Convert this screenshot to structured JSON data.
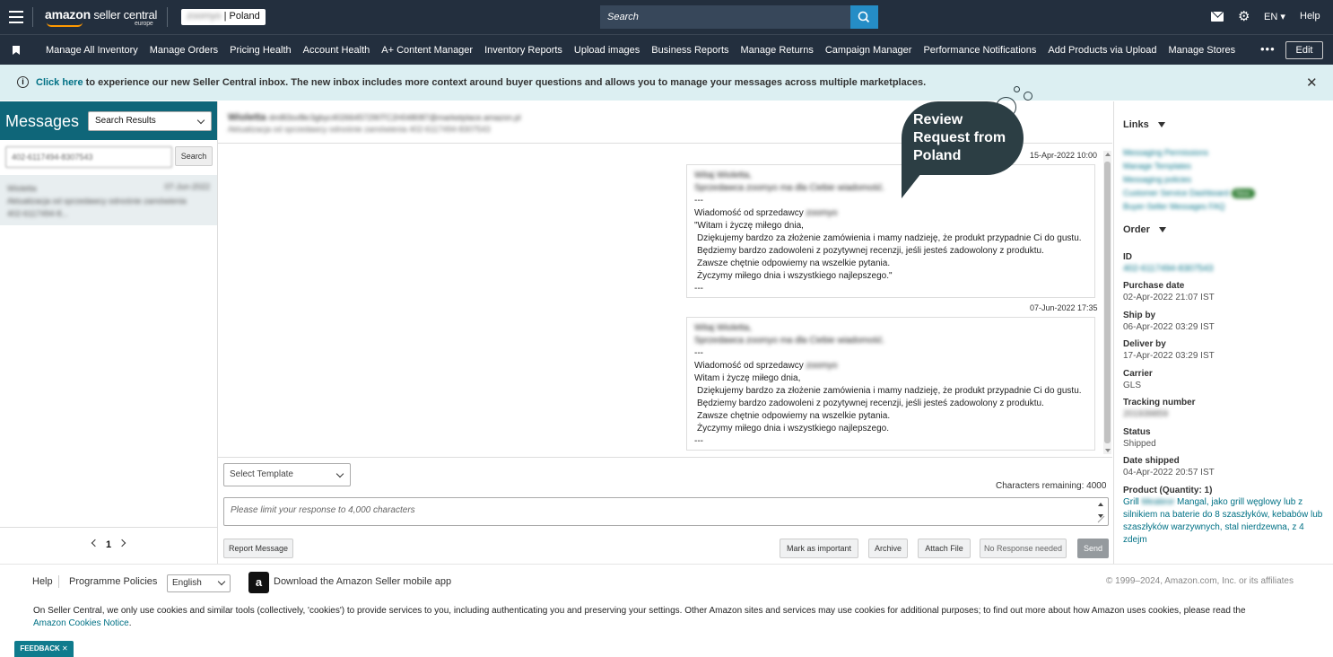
{
  "topbar": {
    "logo_main": "amazon",
    "logo_rest": " seller central",
    "logo_sub": "europe",
    "store_name": "zoomyo",
    "store_country": " | Poland",
    "search_placeholder": "Search",
    "lang": "EN ▾",
    "help": "Help"
  },
  "nav": {
    "items": [
      "Manage All Inventory",
      "Manage Orders",
      "Pricing Health",
      "Account Health",
      "A+ Content Manager",
      "Inventory Reports",
      "Upload images",
      "Business Reports",
      "Manage Returns",
      "Campaign Manager",
      "Performance Notifications",
      "Add Products via Upload",
      "Manage Stores"
    ],
    "more": "•••",
    "edit": "Edit"
  },
  "banner": {
    "link": "Click here",
    "text": " to experience our new Seller Central inbox. The new inbox includes more context around buyer questions and allows you to manage your messages across multiple marketplaces.",
    "close": "✕"
  },
  "left": {
    "title": "Messages",
    "filter": "Search Results",
    "search_value": "402-6117494-8307543",
    "search_btn": "Search",
    "conversation": {
      "name": "Wioletta",
      "date": "07-Jun-2022",
      "line1": "Aktualizacja od sprzedawcy odnośnie zamówienia",
      "line2": "402-6117494-8..."
    },
    "page": "1"
  },
  "center": {
    "buyer_name": "Wioletta",
    "buyer_email": "dm8l3sv8kr3gbyc40266457290TC2H048087@marketplace.amazon.pl",
    "subject": "Aktualizacja od sprzedawcy odnośnie zamówienia 402-6117494-8307543",
    "messages": [
      {
        "timestamp": "15-Apr-2022 10:00",
        "greeting": "Witaj Wioletta,",
        "intro": "Sprzedawca zoomyo ma dla Ciebie wiadomość.",
        "sep1": "---",
        "from_label": "Wiadomość od sprzedawcy ",
        "from_name": "zoomyo",
        "l1": "\"Witam i życzę miłego dnia,",
        "l2": "Dziękujemy bardzo za złożenie zamówienia i mamy nadzieję, że produkt przypadnie Ci do gustu.",
        "l3": "Będziemy bardzo zadowoleni z pozytywnej recenzji, jeśli jesteś zadowolony z produktu.",
        "l4": "Zawsze chętnie odpowiemy na wszelkie pytania.",
        "l5": "Życzymy miłego dnia i wszystkiego najlepszego.\"",
        "sep2": "---"
      },
      {
        "timestamp": "07-Jun-2022 17:35",
        "greeting": "Witaj Wioletta,",
        "intro": "Sprzedawca zoomyo ma dla Ciebie wiadomość.",
        "sep1": "---",
        "from_label": "Wiadomość od sprzedawcy ",
        "from_name": "zoomyo",
        "l1": "Witam i życzę miłego dnia,",
        "l2": "Dziękujemy bardzo za złożenie zamówienia i mamy nadzieję, że produkt przypadnie Ci do gustu.",
        "l3": "Będziemy bardzo zadowoleni z pozytywnej recenzji, jeśli jesteś zadowolony z produktu.",
        "l4": "Zawsze chętnie odpowiemy na wszelkie pytania.",
        "l5": "Życzymy miłego dnia i wszystkiego najlepszego.",
        "sep2": "---"
      }
    ],
    "template": "Select Template",
    "chars_remaining": "Characters remaining: 4000",
    "reply_placeholder": "Please limit your response to 4,000 characters",
    "buttons": {
      "report": "Report Message",
      "important": "Mark as important",
      "archive": "Archive",
      "attach": "Attach File",
      "noresp": "No Response needed",
      "send": "Send"
    }
  },
  "callout": {
    "text": "Review Request from Poland"
  },
  "right": {
    "links_title": "Links",
    "links": [
      "Messaging Permissions",
      "Manage Templates",
      "Messaging policies",
      "Customer Service Dashboard",
      "Buyer-Seller Messages FAQ"
    ],
    "links_pill": "New",
    "order_title": "Order",
    "fields": [
      {
        "label": "ID",
        "value": "402-6117494-8307543"
      },
      {
        "label": "Purchase date",
        "value": "02-Apr-2022 21:07 IST"
      },
      {
        "label": "Ship by",
        "value": "06-Apr-2022 03:29 IST"
      },
      {
        "label": "Deliver by",
        "value": "17-Apr-2022 03:29 IST"
      },
      {
        "label": "Carrier",
        "value": "GLS"
      },
      {
        "label": "Tracking number",
        "value": "201939859"
      },
      {
        "label": "Status",
        "value": "Shipped"
      },
      {
        "label": "Date shipped",
        "value": "04-Apr-2022 20:57 IST"
      }
    ],
    "product_label": "Product (Quantity: 1)",
    "product_pre": "Grill ",
    "product_brand": "Meateor",
    "product_rest": " Mangal, jako grill węglowy lub z silnikiem na baterie do 8 szaszłyków, kebabów lub szaszłyków warzywnych, stal nierdzewna, z 4 zdejm"
  },
  "footer": {
    "help": "Help",
    "policies": "Programme Policies",
    "language": "English",
    "app": "Download the Amazon Seller mobile app",
    "copyright": "© 1999–2024, Amazon.com, Inc. or its affiliates",
    "cookies": "On Seller Central, we only use cookies and similar tools (collectively, 'cookies') to provide services to you, including authenticating you and preserving your settings. Other Amazon sites and services may use cookies for additional purposes; to find out more about how Amazon uses cookies, please read the",
    "cookies_link": "Amazon Cookies Notice",
    "cookies_end": ".",
    "feedback": "FEEDBACK ✕"
  }
}
